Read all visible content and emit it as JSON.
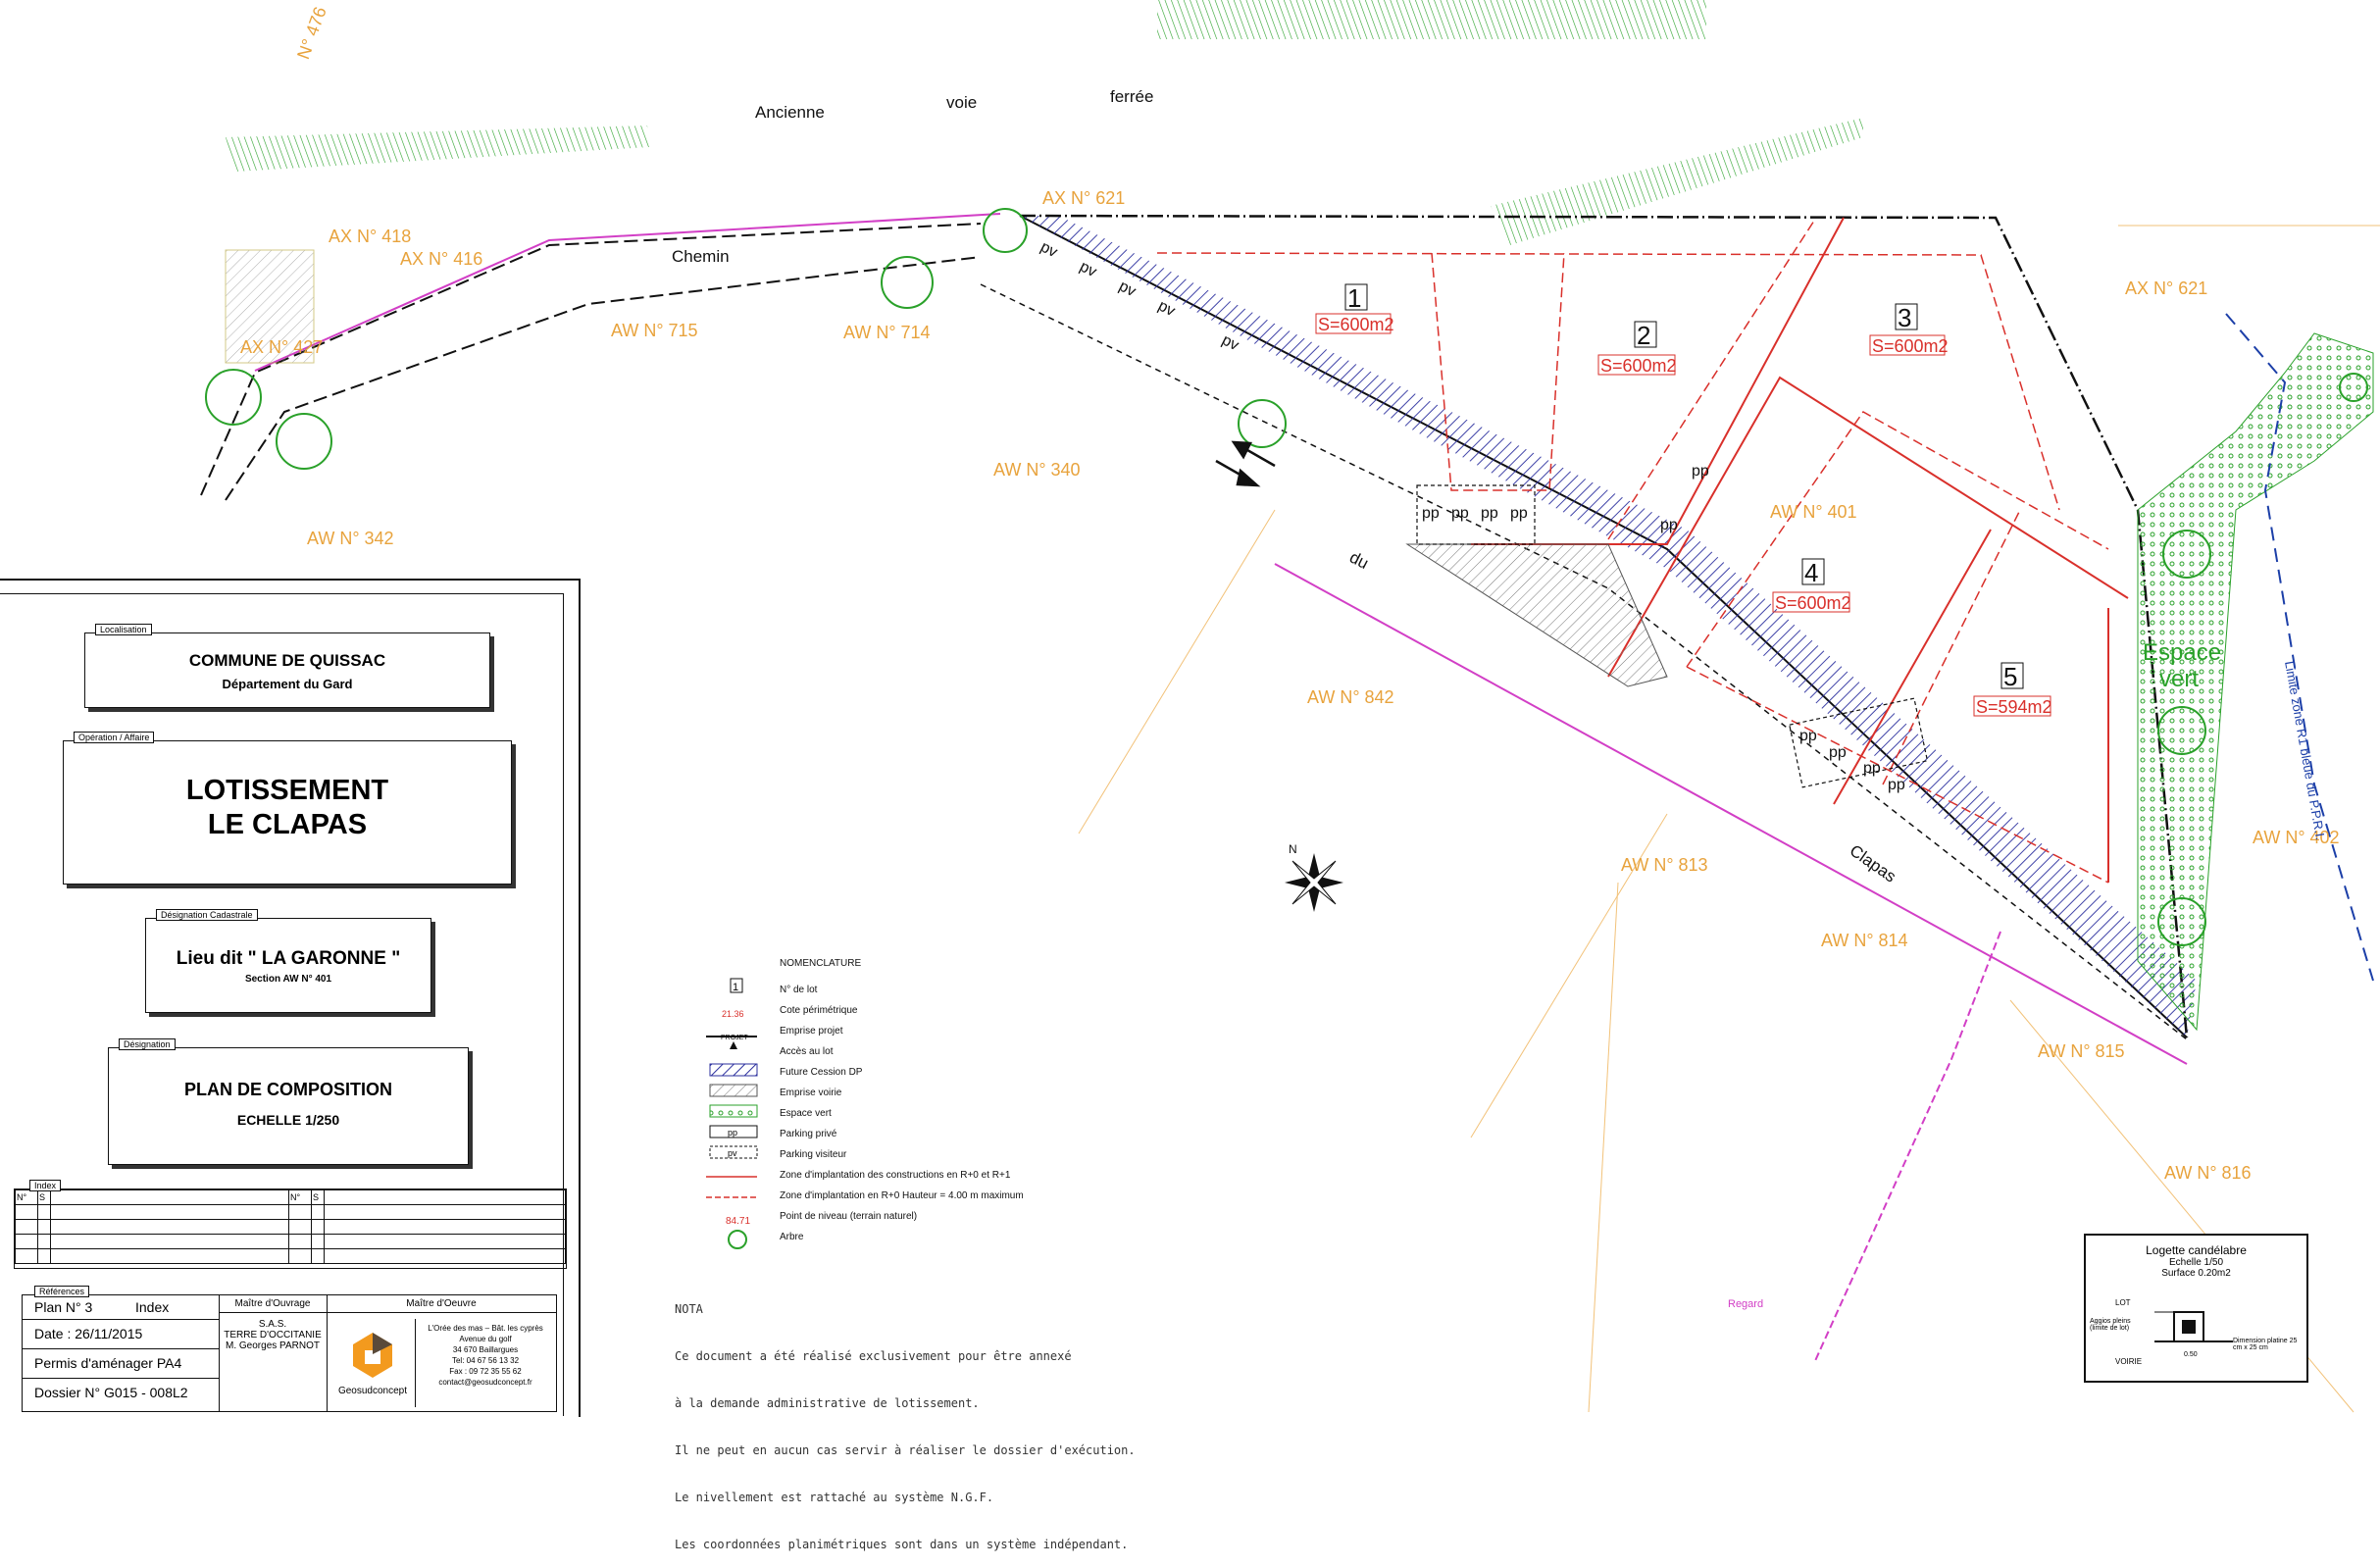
{
  "streets": {
    "ancienne": "Ancienne",
    "voie": "voie",
    "ferree": "ferrée",
    "chemin": "Chemin",
    "du": "du",
    "clapas": "Clapas"
  },
  "parcels": {
    "ax476": "N° 476",
    "ax418": "AX N° 418",
    "ax416": "AX N° 416",
    "ax427": "AX N° 427",
    "ax621_left": "AX N° 621",
    "ax621_right": "AX N° 621",
    "aw715": "AW N° 715",
    "aw714": "AW N° 714",
    "aw340": "AW N° 340",
    "aw342": "AW N° 342",
    "aw401": "AW N° 401",
    "aw842": "AW N° 842",
    "aw813": "AW N° 813",
    "aw814": "AW N° 814",
    "aw815": "AW N° 815",
    "aw816": "AW N° 816",
    "aw402": "AW N° 402"
  },
  "lots": [
    {
      "num": "1",
      "surface": "S=600m2"
    },
    {
      "num": "2",
      "surface": "S=600m2"
    },
    {
      "num": "3",
      "surface": "S=600m2"
    },
    {
      "num": "4",
      "surface": "S=600m2"
    },
    {
      "num": "5",
      "surface": "S=594m2"
    }
  ],
  "labels": {
    "pv": "pv",
    "pp": "pp",
    "espace": "Espace",
    "vert": "vert",
    "limite": "Limite zone R1 bleue du P.P.R.I.",
    "regard": "Regard"
  },
  "title_block": {
    "localisation_tag": "Localisation",
    "commune": "COMMUNE DE QUISSAC",
    "departement": "Département du Gard",
    "operation_tag": "Opération / Affaire",
    "operation_line1": "LOTISSEMENT",
    "operation_line2": "LE CLAPAS",
    "cadastre_tag": "Désignation Cadastrale",
    "lieu_dit": "Lieu dit \" LA GARONNE \"",
    "section": "Section AW N° 401",
    "designation_tag": "Désignation",
    "plan": "PLAN DE COMPOSITION",
    "echelle": "ECHELLE 1/250",
    "index_tag": "Index",
    "index_cols": [
      "N°",
      "S"
    ],
    "references_tag": "Références",
    "plan_no": "Plan N° 3",
    "index_label": "Index",
    "date": "Date : 26/11/2015",
    "permis": "Permis d'aménager  PA4",
    "dossier": "Dossier N° G015 - 008L2",
    "ouvrage_title": "Maître d'Ouvrage",
    "ouvrage_lines": [
      "S.A.S.",
      "TERRE D'OCCITANIE",
      "M. Georges PARNOT"
    ],
    "oeuvre_title": "Maître d'Oeuvre",
    "oeuvre_brand": "Geosudconcept",
    "oeuvre_lines": [
      "L'Orée des mas – Bât. les cyprès",
      "Avenue du golf",
      "34 670 Baillargues",
      "Tel: 04 67 56 13 32",
      "Fax : 09 72 35 55 62",
      "contact@geosudconcept.fr"
    ]
  },
  "legend": {
    "title": "NOMENCLATURE",
    "items": [
      "N° de lot",
      "Cote périmétrique",
      "Emprise projet",
      "Accès au lot",
      "Future Cession DP",
      "Emprise voirie",
      "Espace vert",
      "Parking privé",
      "Parking visiteur",
      "Zone d'implantation des constructions en R+0 et R+1",
      "Zone d'implantation en R+0 Hauteur = 4.00 m maximum",
      "Point de niveau (terrain naturel)",
      "Arbre"
    ],
    "sample_cote": "21.36",
    "sample_level": "84.71",
    "sample_lot": "1",
    "sample_pp": "pp",
    "sample_pv": "pv",
    "sample_projet": "PROJET"
  },
  "note": {
    "title": "NOTA",
    "lines": [
      "Ce document a été réalisé exclusivement pour être annexé",
      "à la demande administrative de lotissement.",
      "Il ne peut en aucun cas servir à réaliser le dossier d'exécution.",
      "Le nivellement est rattaché au système N.G.F.",
      "Les coordonnées planimétriques sont dans un système indépendant."
    ]
  },
  "logette": {
    "title": "Logette candélabre",
    "scale": "Echelle 1/50",
    "surface": "Surface 0.20m2",
    "lot": "LOT",
    "aggios": "Aggios pleins (limite de lot)",
    "voirie": "VOIRIE",
    "dim": "Dimension platine 25 cm x 25 cm",
    "dim_small": "0.50"
  },
  "compass": "N",
  "colors": {
    "parcel_label": "#e8a33d",
    "boundary_red": "#d9302b",
    "cession_blue": "#2b2f9e",
    "tree_green": "#2aa12a",
    "point_purple": "#5a2ea6",
    "limite_blue": "#1c3fa8",
    "pink": "#d23fc6"
  }
}
